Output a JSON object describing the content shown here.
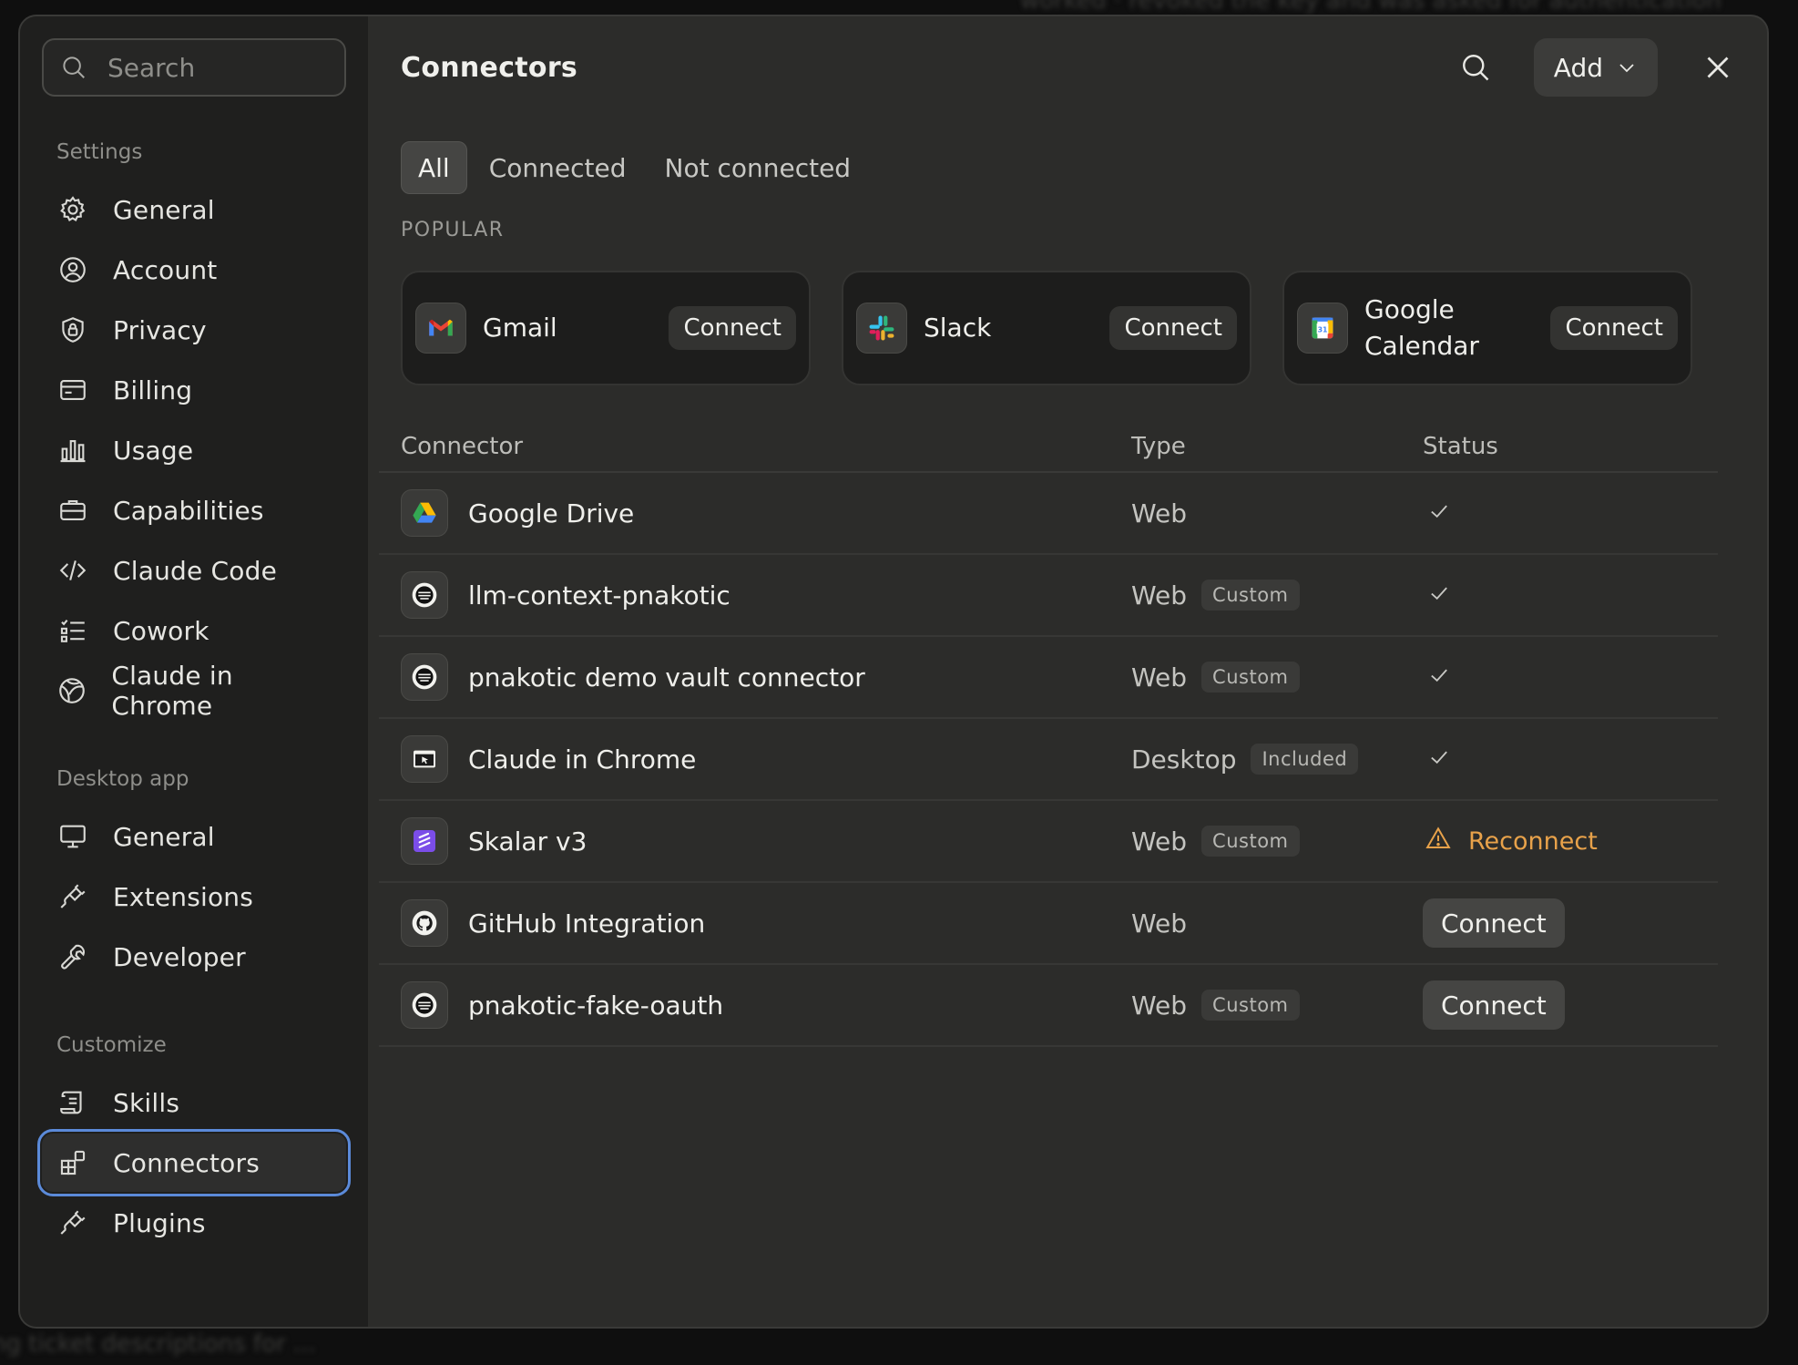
{
  "sidebar": {
    "search_placeholder": "Search",
    "sections": [
      {
        "label": "Settings",
        "items": [
          {
            "label": "General",
            "icon": "gear-icon"
          },
          {
            "label": "Account",
            "icon": "user-circle-icon"
          },
          {
            "label": "Privacy",
            "icon": "shield-lock-icon"
          },
          {
            "label": "Billing",
            "icon": "credit-card-icon"
          },
          {
            "label": "Usage",
            "icon": "bar-chart-icon"
          },
          {
            "label": "Capabilities",
            "icon": "briefcase-icon"
          },
          {
            "label": "Claude Code",
            "icon": "code-icon"
          },
          {
            "label": "Cowork",
            "icon": "checklist-icon"
          },
          {
            "label": "Claude in Chrome",
            "icon": "globe-icon"
          }
        ]
      },
      {
        "label": "Desktop app",
        "items": [
          {
            "label": "General",
            "icon": "monitor-icon"
          },
          {
            "label": "Extensions",
            "icon": "plug-icon"
          },
          {
            "label": "Developer",
            "icon": "wrench-icon"
          }
        ]
      },
      {
        "label": "Customize",
        "items": [
          {
            "label": "Skills",
            "icon": "scroll-icon"
          },
          {
            "label": "Connectors",
            "icon": "blocks-icon",
            "active": true
          },
          {
            "label": "Plugins",
            "icon": "plug-icon"
          }
        ]
      }
    ]
  },
  "header": {
    "title": "Connectors",
    "add_label": "Add"
  },
  "tabs": [
    {
      "label": "All",
      "active": true
    },
    {
      "label": "Connected"
    },
    {
      "label": "Not connected"
    }
  ],
  "popular": {
    "label": "POPULAR",
    "cards": [
      {
        "name": "Gmail",
        "icon": "gmail-icon",
        "action": "Connect"
      },
      {
        "name": "Slack",
        "icon": "slack-icon",
        "action": "Connect"
      },
      {
        "name": "Google Calendar",
        "icon": "google-calendar-icon",
        "action": "Connect"
      }
    ]
  },
  "table": {
    "headers": {
      "connector": "Connector",
      "type": "Type",
      "status": "Status"
    },
    "rows": [
      {
        "name": "Google Drive",
        "icon": "google-drive-icon",
        "type": "Web",
        "badge": "",
        "status": "connected"
      },
      {
        "name": "llm-context-pnakotic",
        "icon": "server-icon",
        "type": "Web",
        "badge": "Custom",
        "status": "connected"
      },
      {
        "name": "pnakotic demo vault connector",
        "icon": "server-icon",
        "type": "Web",
        "badge": "Custom",
        "status": "connected"
      },
      {
        "name": "Claude in Chrome",
        "icon": "browser-cursor-icon",
        "type": "Desktop",
        "badge": "Included",
        "status": "connected"
      },
      {
        "name": "Skalar v3",
        "icon": "skalar-icon",
        "type": "Web",
        "badge": "Custom",
        "status": "reconnect",
        "status_label": "Reconnect"
      },
      {
        "name": "GitHub Integration",
        "icon": "github-icon",
        "type": "Web",
        "badge": "",
        "status": "connect",
        "status_label": "Connect"
      },
      {
        "name": "pnakotic-fake-oauth",
        "icon": "server-icon",
        "type": "Web",
        "badge": "Custom",
        "status": "connect",
        "status_label": "Connect"
      }
    ]
  },
  "colors": {
    "accent_outline": "#5b8ad9",
    "warning": "#e8a24a",
    "background": "#2c2c2a",
    "sidebar": "#1f1f1e"
  }
}
